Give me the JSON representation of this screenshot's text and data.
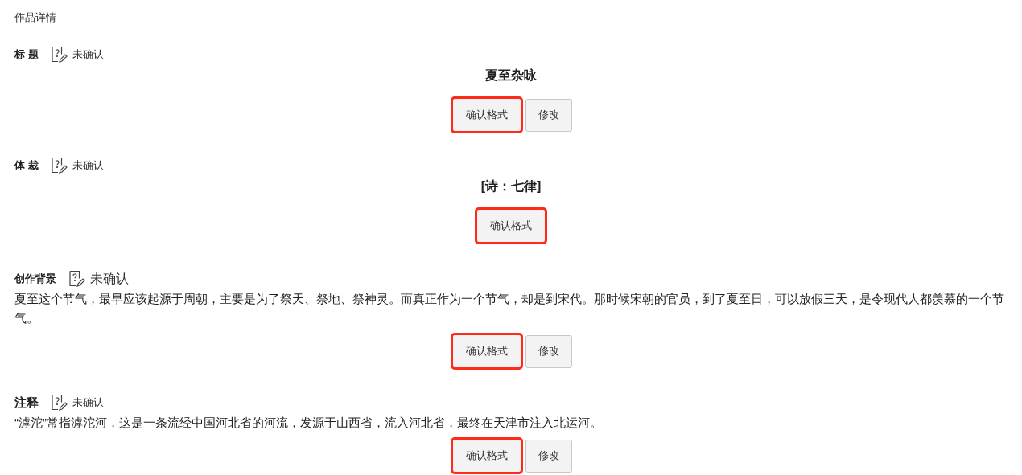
{
  "header": {
    "title": "作品详情"
  },
  "sections": [
    {
      "label": "标 题",
      "status": "未确认",
      "kind": "heading",
      "content": "夏至杂咏",
      "buttons": [
        {
          "label": "确认格式",
          "highlighted": true
        },
        {
          "label": "修改",
          "highlighted": false
        }
      ]
    },
    {
      "label": "体 裁",
      "status": "未确认",
      "kind": "heading",
      "content": "[诗：七律]",
      "buttons": [
        {
          "label": "确认格式",
          "highlighted": true
        }
      ]
    },
    {
      "label": "创作背景",
      "status": "未确认",
      "kind": "paragraph",
      "content": "夏至这个节气，最早应该起源于周朝，主要是为了祭天、祭地、祭神灵。而真正作为一个节气，却是到宋代。那时候宋朝的官员，到了夏至日，可以放假三天，是令现代人都羡慕的一个节气。",
      "buttons": [
        {
          "label": "确认格式",
          "highlighted": true
        },
        {
          "label": "修改",
          "highlighted": false
        }
      ]
    },
    {
      "label": "注释",
      "status": "未确认",
      "kind": "paragraph",
      "content": "“滹沱”常指滹沱河，这是一条流经中国河北省的河流，发源于山西省，流入河北省，最终在天津市注入北运河。",
      "buttons": [
        {
          "label": "确认格式",
          "highlighted": true
        },
        {
          "label": "修改",
          "highlighted": false
        }
      ]
    }
  ]
}
